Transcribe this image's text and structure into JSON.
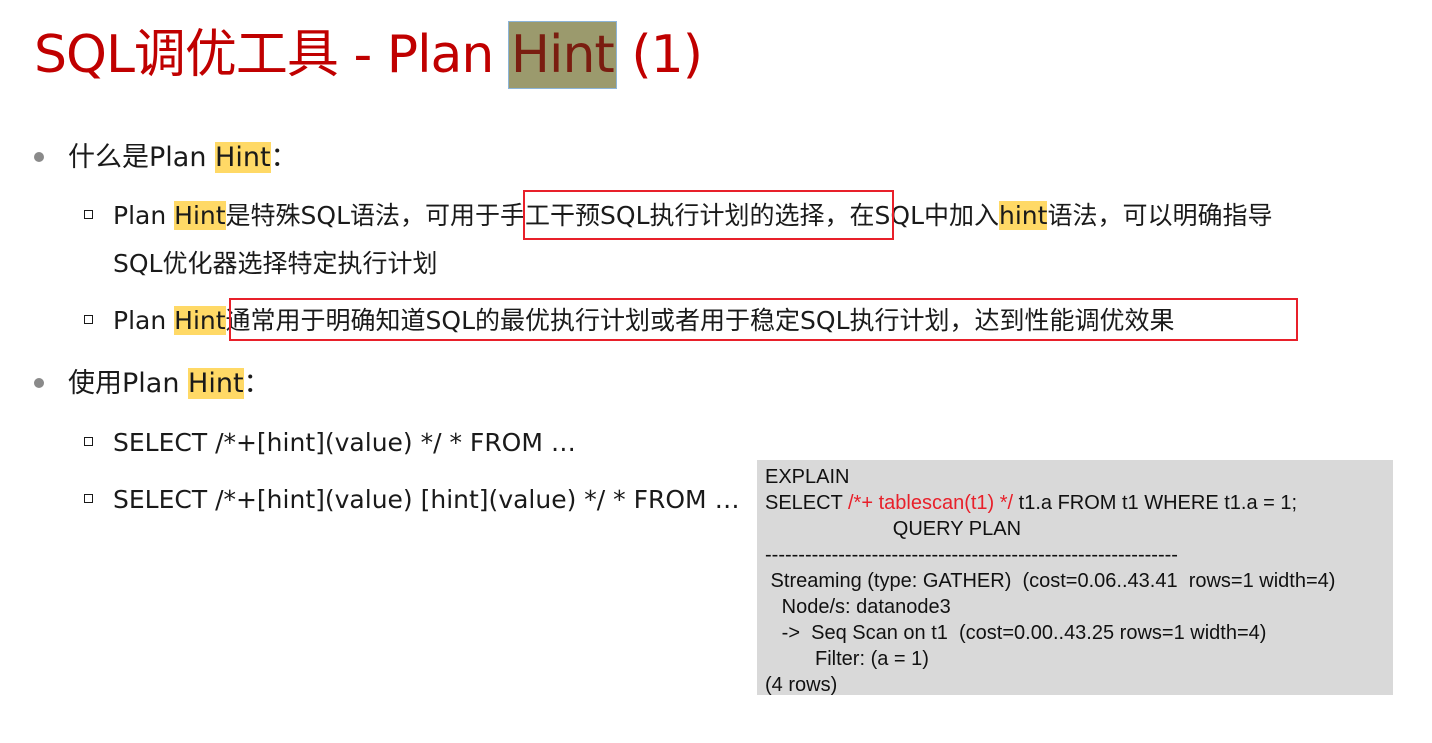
{
  "title": {
    "prefix": "SQL调优工具 - Plan ",
    "hint": "Hint",
    "suffix": " (1)"
  },
  "bullets": [
    {
      "label_prefix": "什么是Plan ",
      "label_hint": "Hint",
      "label_suffix": "："
    },
    {
      "label_prefix": "使用Plan ",
      "label_hint": "Hint",
      "label_suffix": "："
    }
  ],
  "sub1": {
    "line1_a": "Plan ",
    "line1_hint": "Hint",
    "line1_b": "是特殊SQL语法，可用于",
    "line1_boxed": "手工干预SQL执行计划的选择",
    "line1_c": "，在SQL中加入",
    "line1_hint2": "hint",
    "line1_d": "语法，可以明确指导",
    "line2": "SQL优化器选择特定执行计划"
  },
  "sub2": {
    "a": "Plan ",
    "hint": "Hint",
    "boxed": "通常用于明确知道SQL的最优执行计划或者用于稳定SQL执行计划，达到性能调优效果"
  },
  "usage": [
    "SELECT /*+[hint](value) */ * FROM …",
    "SELECT /*+[hint](value)  [hint](value) */ * FROM …"
  ],
  "code": {
    "l1": "EXPLAIN",
    "l2_a": "SELECT ",
    "l2_red": "/*+ tablescan(t1) */",
    "l2_b": " t1.a FROM t1 WHERE t1.a = 1;",
    "l3": "                       QUERY PLAN",
    "l4": "--------------------------------------------------------------",
    "l5": " Streaming (type: GATHER)  (cost=0.06..43.41  rows=1 width=4)",
    "l6": "   Node/s: datanode3",
    "l7": "   ->  Seq Scan on t1  (cost=0.00..43.25 rows=1 width=4)",
    "l8": "         Filter: (a = 1)",
    "l9": "(4 rows)"
  }
}
